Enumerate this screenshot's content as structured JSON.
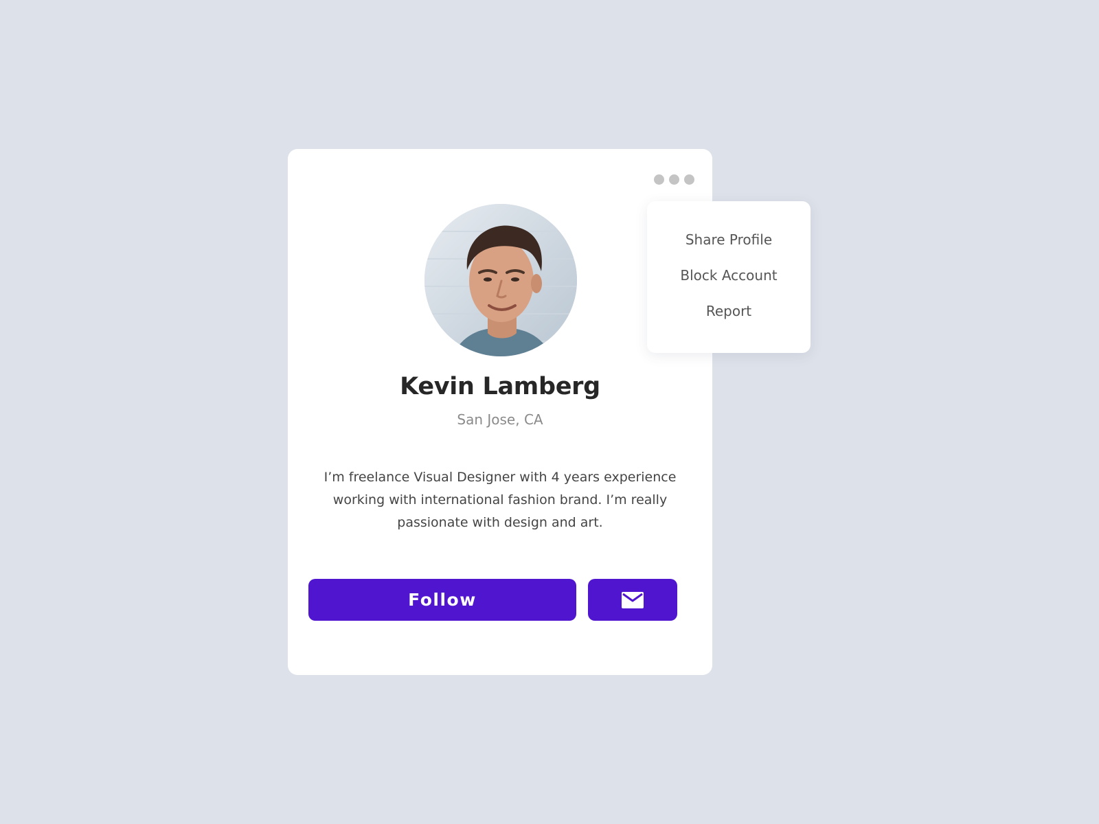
{
  "profile": {
    "name": "Kevin Lamberg",
    "location": "San Jose, CA",
    "bio": "I’m freelance Visual Designer with 4 years experience working with international fashion brand. I’m really passionate with design and art.",
    "avatar_icon": "profile-photo"
  },
  "actions": {
    "follow_label": "Follow",
    "message_icon": "mail-icon",
    "more_icon": "more-dots-icon"
  },
  "menu": {
    "items": [
      {
        "label": "Share Profile"
      },
      {
        "label": "Block Account"
      },
      {
        "label": "Report"
      }
    ]
  },
  "colors": {
    "background": "#dde1e9",
    "card": "#ffffff",
    "accent": "#5016cf",
    "name_text": "#272727",
    "muted_text": "#8a8a8a",
    "body_text": "#444444",
    "dots": "#c4c4c4"
  }
}
